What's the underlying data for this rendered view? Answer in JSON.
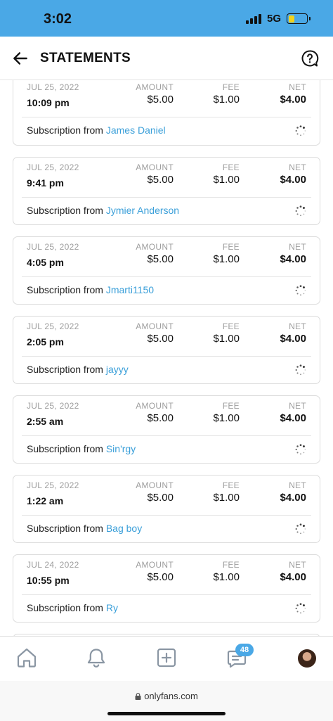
{
  "status_bar": {
    "time": "3:02",
    "network": "5G",
    "battery_level": 0.35,
    "accent_color": "#4aa8e6"
  },
  "header": {
    "title": "STATEMENTS"
  },
  "labels": {
    "amount": "AMOUNT",
    "fee": "FEE",
    "net": "NET",
    "subscription_prefix": "Subscription from "
  },
  "statements": [
    {
      "date": "JUL 25, 2022",
      "time": "10:09 pm",
      "amount": "$5.00",
      "fee": "$1.00",
      "net": "$4.00",
      "from": "James Daniel"
    },
    {
      "date": "JUL 25, 2022",
      "time": "9:41 pm",
      "amount": "$5.00",
      "fee": "$1.00",
      "net": "$4.00",
      "from": "Jymier Anderson"
    },
    {
      "date": "JUL 25, 2022",
      "time": "4:05 pm",
      "amount": "$5.00",
      "fee": "$1.00",
      "net": "$4.00",
      "from": "Jmarti1150"
    },
    {
      "date": "JUL 25, 2022",
      "time": "2:05 pm",
      "amount": "$5.00",
      "fee": "$1.00",
      "net": "$4.00",
      "from": "jayyy"
    },
    {
      "date": "JUL 25, 2022",
      "time": "2:55 am",
      "amount": "$5.00",
      "fee": "$1.00",
      "net": "$4.00",
      "from": "Sin'rgy"
    },
    {
      "date": "JUL 25, 2022",
      "time": "1:22 am",
      "amount": "$5.00",
      "fee": "$1.00",
      "net": "$4.00",
      "from": "Bag boy"
    },
    {
      "date": "JUL 24, 2022",
      "time": "10:55 pm",
      "amount": "$5.00",
      "fee": "$1.00",
      "net": "$4.00",
      "from": "Ry"
    }
  ],
  "bottom_nav": {
    "items": [
      "home-icon",
      "bell-icon",
      "add-post-icon",
      "messages-icon",
      "avatar"
    ],
    "messages_badge": "48"
  },
  "browser": {
    "url": "onlyfans.com"
  }
}
